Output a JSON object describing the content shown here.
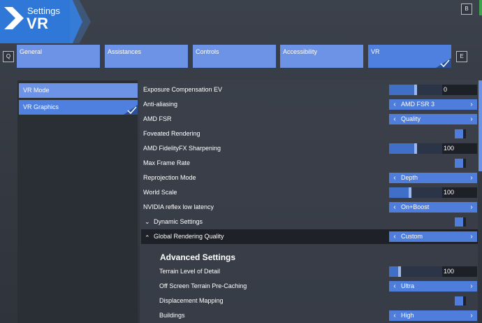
{
  "header": {
    "title": "Settings",
    "subtitle": "VR"
  },
  "hints": {
    "back": "B",
    "tab_prev": "Q",
    "tab_next": "E"
  },
  "tabs": [
    {
      "label": "General"
    },
    {
      "label": "Assistances"
    },
    {
      "label": "Controls"
    },
    {
      "label": "Accessibility"
    },
    {
      "label": "VR"
    }
  ],
  "active_tab": "VR",
  "sidebar": {
    "items": [
      {
        "label": "VR Mode"
      },
      {
        "label": "VR Graphics"
      }
    ],
    "active": "VR Graphics"
  },
  "settings": {
    "exposure": {
      "label": "Exposure Compensation EV",
      "value": "0",
      "level": 0.5
    },
    "anti_aliasing": {
      "label": "Anti-aliasing",
      "value": "AMD FSR 3"
    },
    "amd_fsr": {
      "label": "AMD FSR",
      "value": "Quality"
    },
    "foveated": {
      "label": "Foveated Rendering",
      "enabled": true
    },
    "sharpening": {
      "label": "AMD FidelityFX Sharpening",
      "value": "100",
      "level": 0.5
    },
    "max_frame_rate": {
      "label": "Max Frame Rate",
      "enabled": true
    },
    "reprojection": {
      "label": "Reprojection Mode",
      "value": "Depth"
    },
    "world_scale": {
      "label": "World Scale",
      "value": "100",
      "level": 0.4
    },
    "nvidia_reflex": {
      "label": "NVIDIA reflex low latency",
      "value": "On+Boost"
    },
    "dynamic_settings": {
      "label": "Dynamic Settings",
      "enabled": true
    },
    "global_quality": {
      "label": "Global Rendering Quality",
      "value": "Custom"
    }
  },
  "advanced": {
    "title": "Advanced Settings",
    "terrain_lod": {
      "label": "Terrain Level of Detail",
      "value": "100",
      "level": 0.2
    },
    "offscreen_caching": {
      "label": "Off Screen Terrain Pre-Caching",
      "value": "Ultra"
    },
    "displacement": {
      "label": "Displacement Mapping",
      "enabled": true
    },
    "buildings": {
      "label": "Buildings",
      "value": "High"
    }
  },
  "icons": {
    "logo": "chevron-logo-icon",
    "check": "checkmark-icon",
    "arrow_left": "arrow-left-icon",
    "arrow_right": "arrow-right-icon",
    "caret_down": "chevron-down-icon",
    "caret_up": "chevron-up-icon"
  },
  "colors": {
    "accent": "#4f80e0",
    "tab": "#6c93e6",
    "banner": "#2f78d8"
  }
}
